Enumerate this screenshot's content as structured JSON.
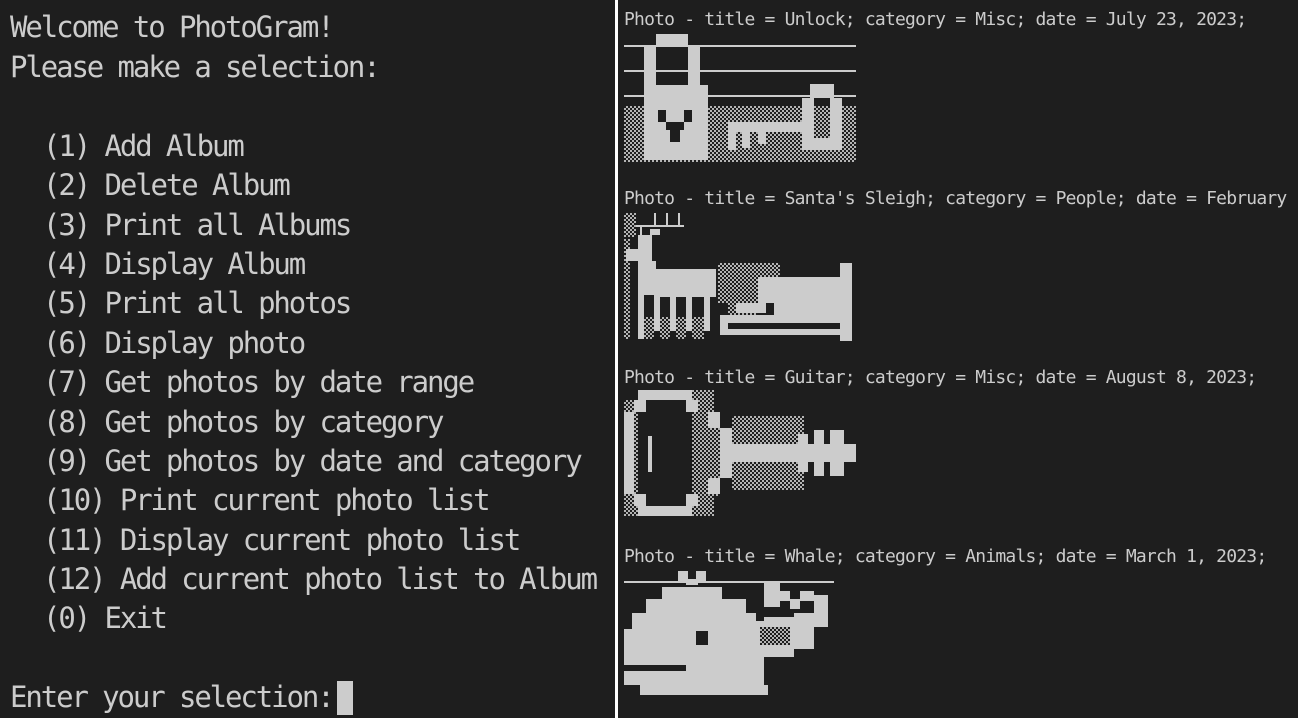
{
  "menu": {
    "welcome": "Welcome to PhotoGram!",
    "prompt_header": "Please make a selection:",
    "items": [
      {
        "key": "(1)",
        "label": "Add Album"
      },
      {
        "key": "(2)",
        "label": "Delete Album"
      },
      {
        "key": "(3)",
        "label": "Print all Albums"
      },
      {
        "key": "(4)",
        "label": "Display Album"
      },
      {
        "key": "(5)",
        "label": "Print all photos"
      },
      {
        "key": "(6)",
        "label": "Display photo"
      },
      {
        "key": "(7)",
        "label": "Get photos by date range"
      },
      {
        "key": "(8)",
        "label": "Get photos by category"
      },
      {
        "key": "(9)",
        "label": "Get photos by date and category"
      },
      {
        "key": "(10)",
        "label": "Print current photo list"
      },
      {
        "key": "(11)",
        "label": "Display current photo list"
      },
      {
        "key": "(12)",
        "label": "Add current photo list to Album"
      },
      {
        "key": "(0)",
        "label": "Exit"
      }
    ],
    "input_prompt": "Enter your selection:"
  },
  "photos": [
    {
      "caption": "Photo - title = Unlock; category = Misc; date = July 23, 2023;",
      "art_icon": "lock-and-key-icon"
    },
    {
      "caption": "Photo - title = Santa's Sleigh; category = People; date = February",
      "art_icon": "reindeer-sleigh-icon"
    },
    {
      "caption": "Photo - title = Guitar; category = Misc; date = August 8, 2023;",
      "art_icon": "guitar-icon"
    },
    {
      "caption": "Photo - title = Whale; category = Animals; date = March 1, 2023;",
      "art_icon": "whale-icon"
    }
  ],
  "colors": {
    "background": "#1e1e1e",
    "text": "#cccccc",
    "divider": "#ffffff"
  }
}
